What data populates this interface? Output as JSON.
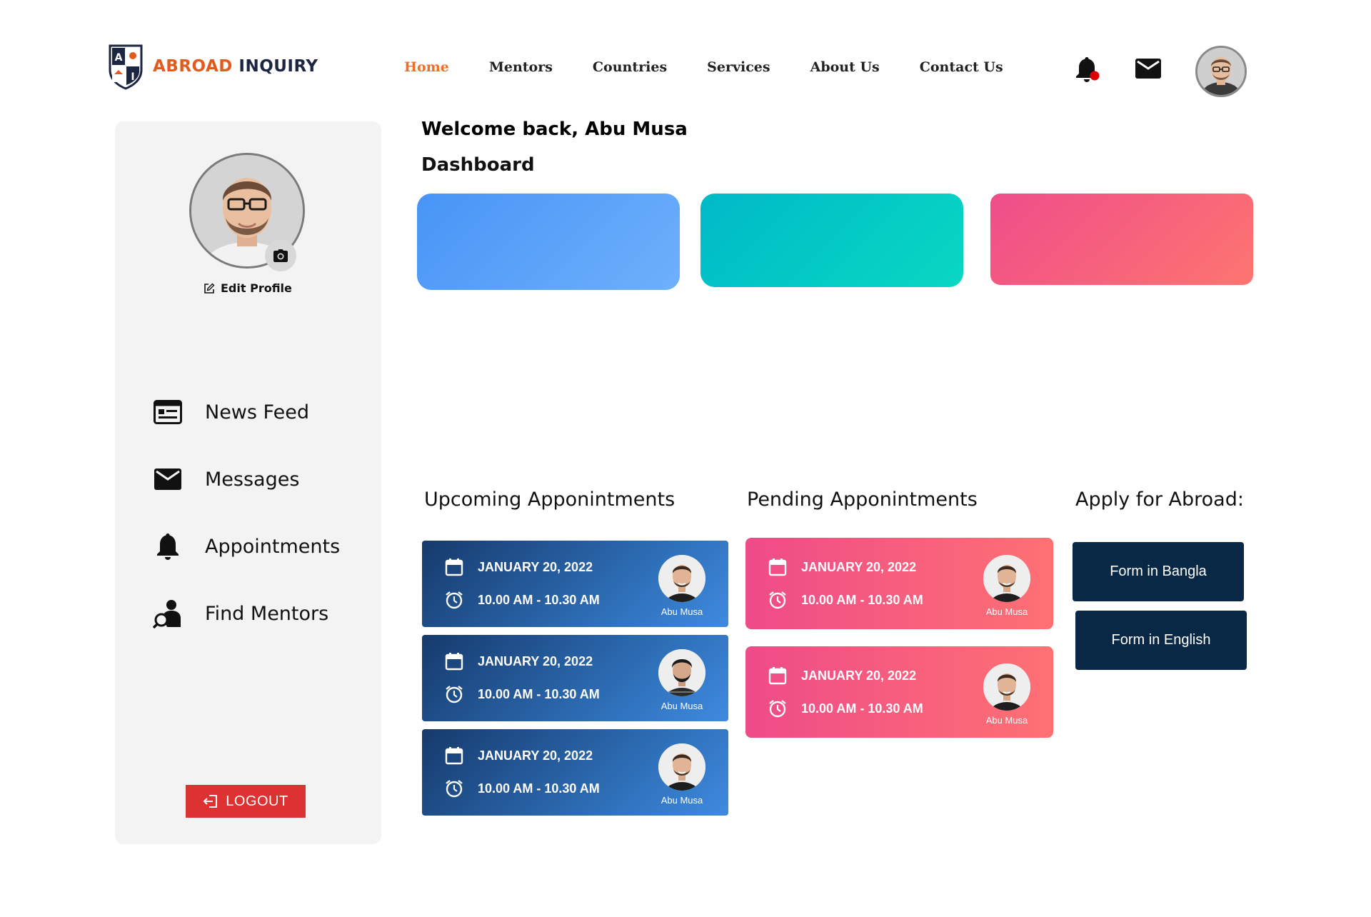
{
  "brand": {
    "word1": "ABROAD",
    "word2": "INQUIRY",
    "shield_letters": [
      "A",
      "I"
    ]
  },
  "nav": {
    "items": [
      {
        "label": "Home",
        "active": true
      },
      {
        "label": "Mentors",
        "active": false
      },
      {
        "label": "Countries",
        "active": false
      },
      {
        "label": "Services",
        "active": false
      },
      {
        "label": "About Us",
        "active": false
      },
      {
        "label": "Contact Us",
        "active": false
      }
    ]
  },
  "header_icons": {
    "notifications": "bell-icon",
    "notification_dot_color": "#e00000",
    "messages": "mail-icon",
    "profile": "avatar"
  },
  "sidebar": {
    "edit_profile": "Edit Profile",
    "menu": [
      {
        "label": "News Feed",
        "icon": "newsfeed-icon"
      },
      {
        "label": "Messages",
        "icon": "mail-icon"
      },
      {
        "label": "Appointments",
        "icon": "bell-icon"
      },
      {
        "label": "Find Mentors",
        "icon": "find-mentor-icon"
      }
    ],
    "logout": "LOGOUT"
  },
  "main": {
    "welcome": "Welcome back, Abu Musa",
    "dashboard_title": "Dashboard",
    "stat_cards": [
      {
        "color_from": "#4895f7",
        "color_to": "#6eb0fb"
      },
      {
        "color_from": "#00b9c8",
        "color_to": "#08d8c2"
      },
      {
        "color_from": "#ef4d8a",
        "color_to": "#fd7570"
      }
    ],
    "upcoming": {
      "title": "Upcoming Apponintments",
      "items": [
        {
          "date": "JANUARY 20, 2022",
          "time": "10.00 AM - 10.30 AM",
          "mentor": "Abu Musa"
        },
        {
          "date": "JANUARY 20, 2022",
          "time": "10.00 AM - 10.30 AM",
          "mentor": "Abu Musa"
        },
        {
          "date": "JANUARY 20, 2022",
          "time": "10.00 AM - 10.30 AM",
          "mentor": "Abu Musa"
        }
      ]
    },
    "pending": {
      "title": "Pending Apponintments",
      "items": [
        {
          "date": "JANUARY 20, 2022",
          "time": "10.00 AM - 10.30 AM",
          "mentor": "Abu Musa"
        },
        {
          "date": "JANUARY 20, 2022",
          "time": "10.00 AM - 10.30 AM",
          "mentor": "Abu Musa"
        }
      ]
    },
    "apply": {
      "title": "Apply for Abroad:",
      "buttons": [
        "Form in Bangla",
        "Form in English"
      ]
    }
  },
  "colors": {
    "accent_orange": "#f26c2a",
    "navy": "#082846",
    "logout_red": "#dc3332",
    "sidebar_bg": "#f3f3f3"
  }
}
